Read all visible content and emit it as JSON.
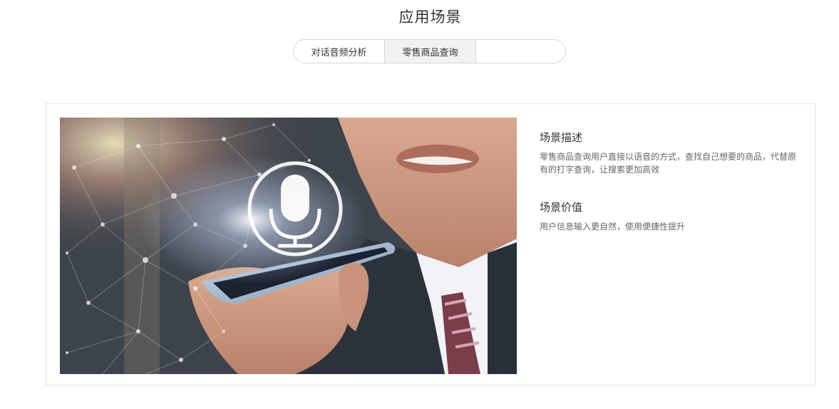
{
  "section": {
    "title": "应用场景"
  },
  "tabs": [
    {
      "label": "对话音频分析"
    },
    {
      "label": "零售商品查询",
      "active": true
    },
    {
      "label": ""
    }
  ],
  "card": {
    "image_icon": "microphone-icon",
    "description_title": "场景描述",
    "description_text": "零售商品查询用户直接以语音的方式，查找自己想要的商品，代替原有的打字查询，让搜索更加高效",
    "value_title": "场景价值",
    "value_text": "用户信息输入更自然，使用便捷性提升"
  }
}
